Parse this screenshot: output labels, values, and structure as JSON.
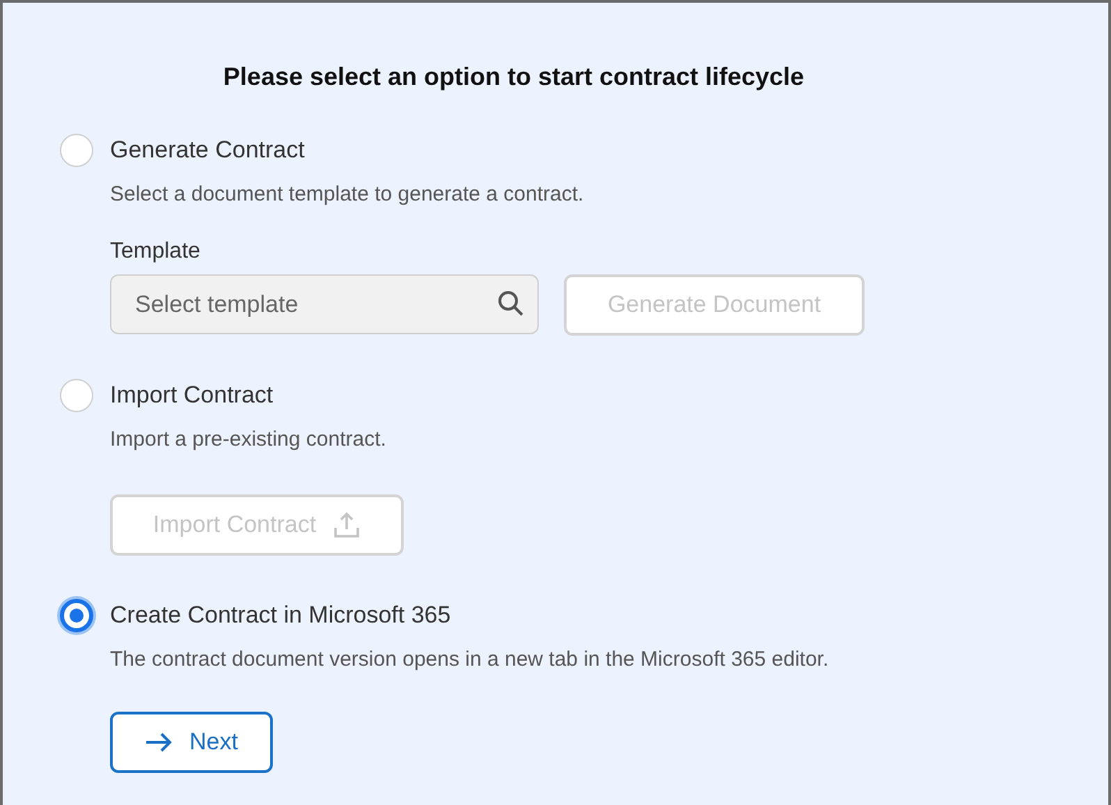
{
  "heading": "Please select an option to start contract lifecycle",
  "options": [
    {
      "kind": "template",
      "title": "Generate Contract",
      "description": "Select a document template to generate a contract.",
      "selected": false,
      "field_label": "Template",
      "field": {
        "placeholder": "Select template"
      },
      "button": {
        "label": "Generate Document",
        "disabled": true
      }
    },
    {
      "kind": "import",
      "title": "Import Contract",
      "description": "Import a pre-existing contract.",
      "selected": false,
      "button": {
        "label": "Import Contract",
        "disabled": true
      }
    },
    {
      "kind": "next",
      "title": "Create Contract in Microsoft 365",
      "description": "The contract document version opens in a new tab in the Microsoft 365 editor.",
      "selected": true,
      "button": {
        "label": "Next",
        "disabled": false
      }
    }
  ]
}
